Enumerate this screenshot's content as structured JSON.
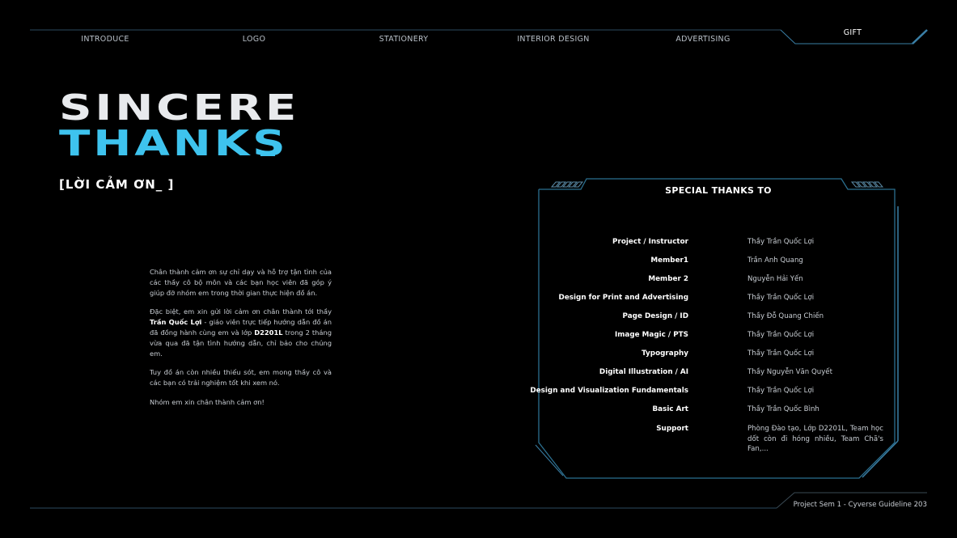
{
  "nav": {
    "items": [
      "INTRODUCE",
      "LOGO",
      "STATIONERY",
      "INTERIOR DESIGN",
      "ADVERTISING",
      "GIFT"
    ],
    "active": "GIFT"
  },
  "hero": {
    "line1": "SINCERE",
    "line2": "THANKS",
    "subtitle": "[LỜI CẢM ƠN_ ]"
  },
  "message": {
    "p1": "Chân thành cảm ơn sự chỉ dạy và hỗ trợ tận tình của các thầy cô bộ môn và các bạn học viên đã góp ý giúp đỡ nhóm em trong thời gian thực hiện đồ án.",
    "p2_pre": "Đặc biệt, em xin gửi lời cảm ơn chân thành tới thầy ",
    "p2_name": "Trần Quốc Lợi",
    "p2_mid": " - giáo viên trực tiếp hướng dẫn đồ án đã đồng hành cùng em và lớp ",
    "p2_class": "D2201L",
    "p2_post": " trong 2 tháng vừa qua đã tận tình hướng dẫn, chỉ bảo cho chúng em.",
    "p3": "Tuy đồ án còn nhiều thiếu sót, em mong thầy cô và các bạn có trải nghiệm tốt khi xem nó.",
    "p4": "Nhóm em xin chân thành cảm ơn!"
  },
  "credits": {
    "title": "SPECIAL THANKS TO",
    "rows": [
      {
        "role": "Project / Instructor",
        "person": "Thầy Trần Quốc Lợi"
      },
      {
        "role": "Member1",
        "person": "Trần Anh Quang"
      },
      {
        "role": "Member 2",
        "person": "Nguyễn Hải Yến"
      },
      {
        "role": "Design for Print and Advertising",
        "person": "Thầy Trần Quốc Lợi"
      },
      {
        "role": "Page Design / ID",
        "person": "Thầy Đỗ Quang Chiến"
      },
      {
        "role": "Image Magic / PTS",
        "person": "Thầy Trần Quốc Lợi"
      },
      {
        "role": "Typography",
        "person": "Thầy Trần Quốc Lợi"
      },
      {
        "role": "Digital Illustration / AI",
        "person": "Thầy Nguyễn Văn Quyết"
      },
      {
        "role": "Design and Visualization Fundamentals",
        "person": "Thầy Trần Quốc Lợi"
      },
      {
        "role": "Basic Art",
        "person": "Thầy Trần Quốc Bình"
      },
      {
        "role": "Support",
        "person": "Phòng Đào tạo, Lớp D2201L, Team học dốt còn đi hóng nhiều, Team Chã's Fan,..."
      }
    ]
  },
  "footer": {
    "text": "Project Sem 1 - Cyverse Guideline 203"
  },
  "colors": {
    "background": "#000000",
    "accent": "#3ec3ee",
    "frame": "#2b6f8f",
    "text": "#c9ced4"
  }
}
